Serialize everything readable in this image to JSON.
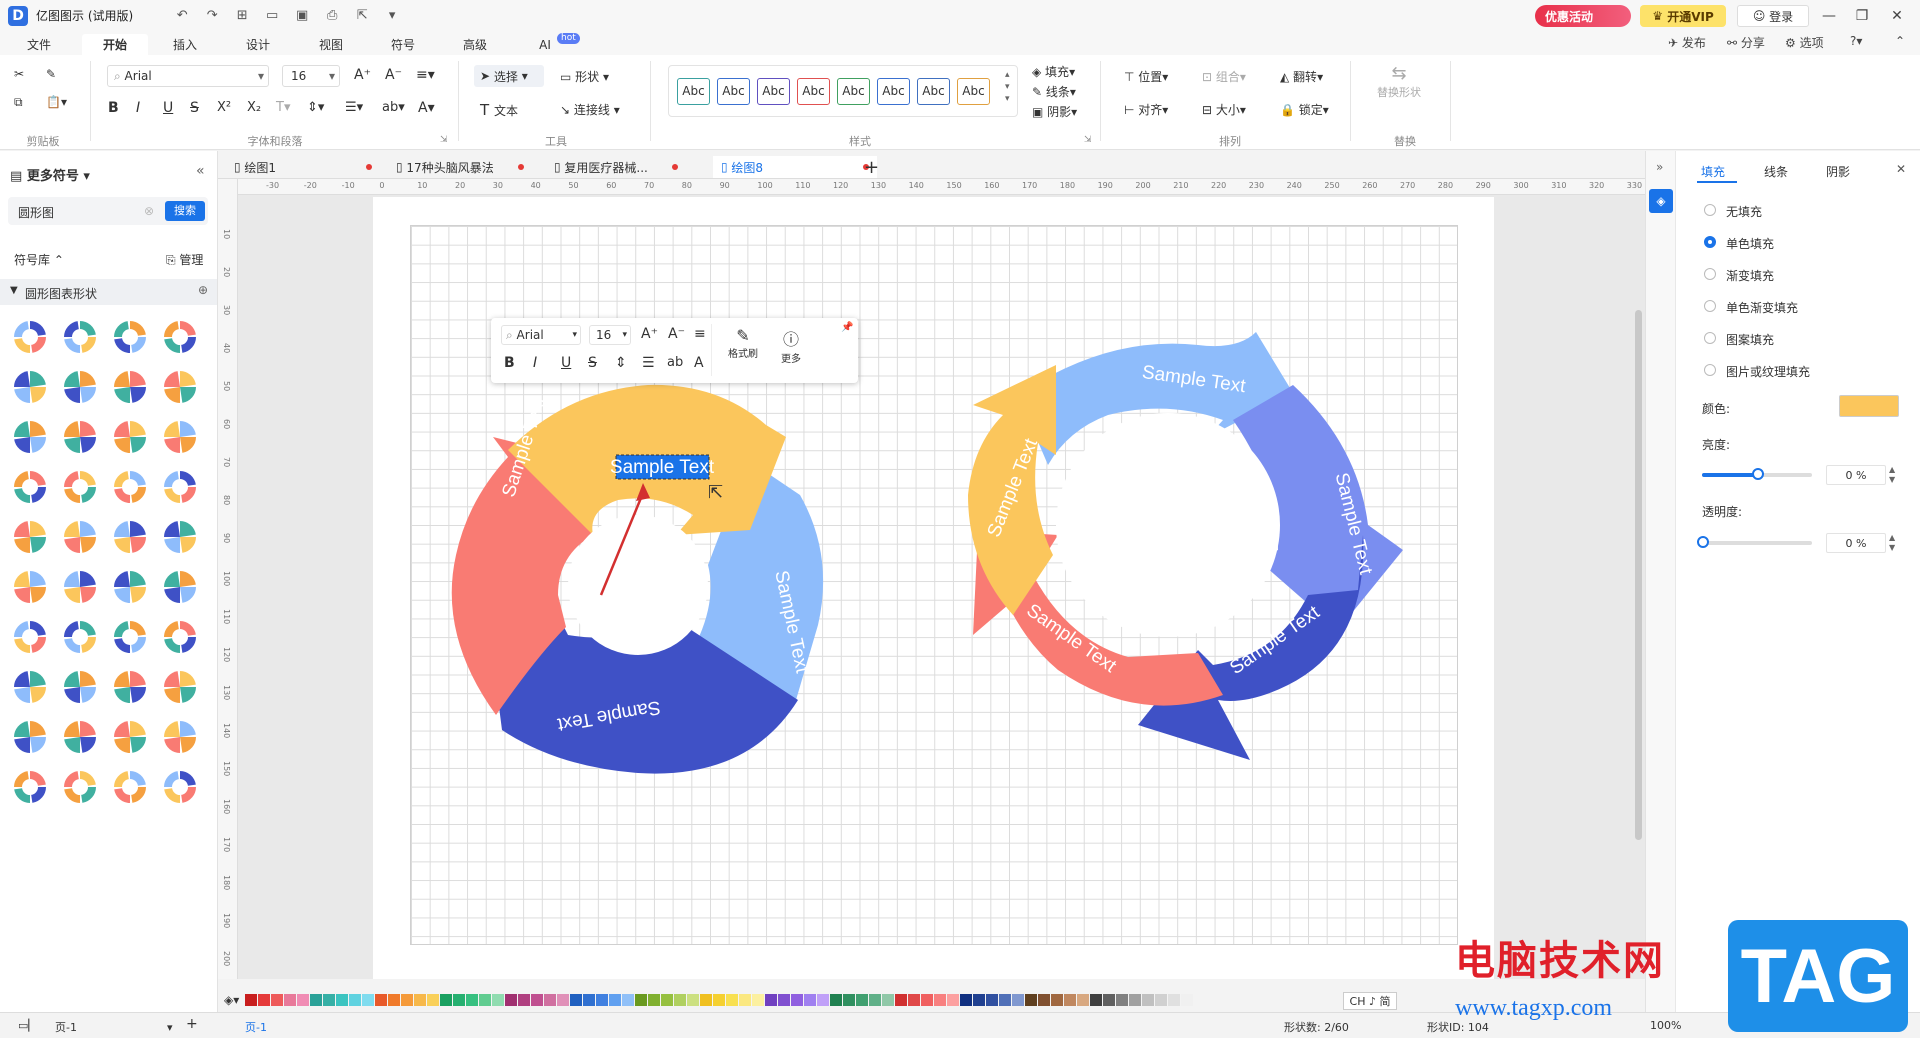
{
  "app": {
    "title": "亿图图示 (试用版)",
    "icon_letter": "D"
  },
  "titlebar": {
    "promo_label": "优惠活动",
    "vip_label": "开通VIP",
    "login_label": "登录"
  },
  "menu": {
    "tabs": [
      "文件",
      "开始",
      "插入",
      "设计",
      "视图",
      "符号",
      "高级",
      "AI"
    ],
    "active": "开始",
    "ai_badge": "hot",
    "right": {
      "publish": "发布",
      "share": "分享",
      "options": "选项"
    }
  },
  "ribbon": {
    "font_name": "Arial",
    "font_size": "16",
    "groups": {
      "clipboard": "剪贴板",
      "font": "字体和段落",
      "tools": "工具",
      "styles": "样式",
      "arrange": "排列",
      "replace": "替换"
    },
    "select_label": "选择",
    "shape_label": "形状",
    "text_label": "文本",
    "connector_label": "连接线",
    "style_sample": "Abc",
    "fill_label": "填充",
    "line_label": "线条",
    "shadow_label": "阴影",
    "position_label": "位置",
    "group_label": "组合",
    "flip_label": "翻转",
    "align_label": "对齐",
    "size_label": "大小",
    "lock_label": "锁定",
    "replace_shape_label": "替换形状"
  },
  "left_panel": {
    "title": "更多符号",
    "search_value": "圆形图",
    "search_button": "搜索",
    "library_label": "符号库",
    "manage_label": "管理",
    "category_label": "圆形图表形状"
  },
  "doc_tabs": [
    {
      "label": "绘图1",
      "active": false
    },
    {
      "label": "17种头脑风暴法",
      "active": false
    },
    {
      "label": "复用医疗器械...",
      "active": false
    },
    {
      "label": "绘图8",
      "active": true
    }
  ],
  "hruler_ticks": [
    "-30",
    "-20",
    "-10",
    "0",
    "10",
    "20",
    "30",
    "40",
    "50",
    "60",
    "70",
    "80",
    "90",
    "100",
    "110",
    "120",
    "130",
    "140",
    "150",
    "160",
    "170",
    "180",
    "190",
    "200",
    "210",
    "220",
    "230",
    "240",
    "250",
    "260",
    "270",
    "280",
    "290",
    "300",
    "310",
    "320",
    "330"
  ],
  "vruler_ticks": [
    "10",
    "20",
    "30",
    "40",
    "50",
    "60",
    "70",
    "80",
    "90",
    "100",
    "110",
    "120",
    "130",
    "140",
    "150",
    "160",
    "170",
    "180",
    "190",
    "200"
  ],
  "float_toolbar": {
    "font_name": "Arial",
    "font_size": "16",
    "format_painter": "格式刷",
    "more": "更多"
  },
  "diagram": {
    "selected_text": "Sample Text",
    "labels": [
      "Sample Text",
      "Sample Text",
      "Sample Text",
      "Sample Text",
      "Sample Text",
      "Sample Text",
      "Sample Text"
    ],
    "colors": {
      "yellow": "#fbc65c",
      "blue_light": "#8ebcfb",
      "blue_mid": "#7a8ef0",
      "blue_dark": "#3f51c6",
      "coral": "#f97b73"
    }
  },
  "right_panel": {
    "tabs": [
      "填充",
      "线条",
      "阴影"
    ],
    "fill_options": [
      "无填充",
      "单色填充",
      "渐变填充",
      "单色渐变填充",
      "图案填充",
      "图片或纹理填充"
    ],
    "selected_fill": "单色填充",
    "color_label": "颜色:",
    "color_value": "#fbc65c",
    "brightness_label": "亮度:",
    "brightness_value": "0 %",
    "transparency_label": "透明度:",
    "transparency_value": "0 %"
  },
  "statusbar": {
    "page_label": "页-1",
    "page_tab": "页-1",
    "shape_count": "形状数: 2/60",
    "shape_id": "形状ID: 104",
    "zoom": "100%",
    "ime": "CH ♪ 简"
  },
  "palette": [
    "#c81e1e",
    "#e53a3a",
    "#ee5a5a",
    "#e8799a",
    "#f08cb4",
    "#2aa198",
    "#36b0a6",
    "#3bc4c0",
    "#5fd2e0",
    "#80dcef",
    "#e85a2a",
    "#f07a2a",
    "#f59a3a",
    "#f7b84a",
    "#f9d05a",
    "#1aa060",
    "#26b070",
    "#36c080",
    "#60cc90",
    "#90dcb0",
    "#a03070",
    "#b04080",
    "#c05090",
    "#d070a0",
    "#e090b8",
    "#2060c0",
    "#3070d0",
    "#4080e0",
    "#60a0f0",
    "#90c0f8",
    "#6a9a20",
    "#80b030",
    "#96c040",
    "#b0d060",
    "#cce080",
    "#f0c020",
    "#f5d030",
    "#f8e050",
    "#fbe880",
    "#fcf0a0",
    "#7040c0",
    "#8050d0",
    "#9060e0",
    "#a080f0",
    "#c0a0f8",
    "#208050",
    "#309060",
    "#40a070",
    "#60b088",
    "#90c8a8",
    "#d03030",
    "#e04848",
    "#f06060",
    "#f88080",
    "#fca0a0",
    "#103080",
    "#204090",
    "#3050a0",
    "#5070b8",
    "#8098d0",
    "#604020",
    "#805030",
    "#a06840",
    "#c08860",
    "#d8a880",
    "#404040",
    "#606060",
    "#808080",
    "#a0a0a0",
    "#c0c0c0",
    "#d0d0d0",
    "#e0e0e0",
    "#f0f0f0"
  ]
}
